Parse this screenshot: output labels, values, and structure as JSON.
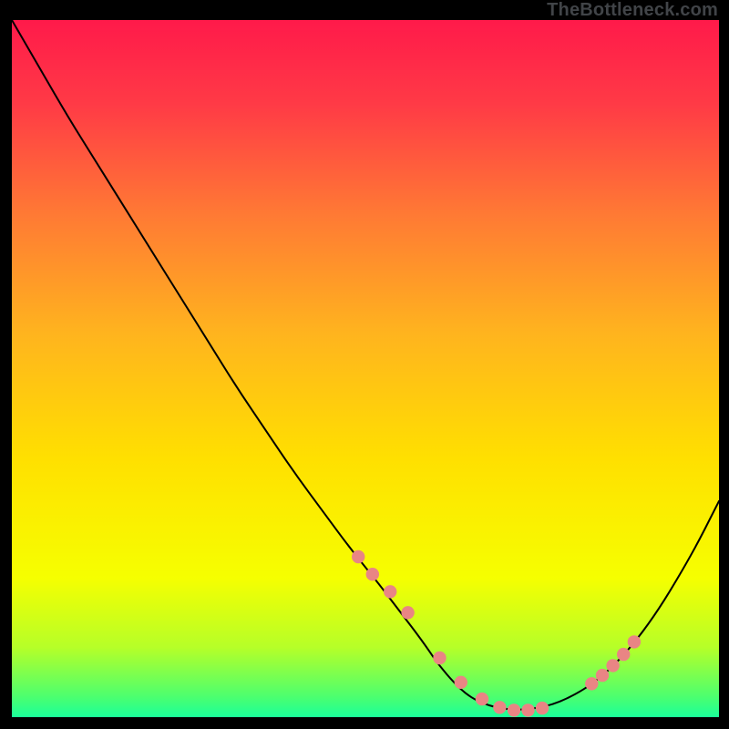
{
  "watermark": "TheBottleneck.com",
  "colors": {
    "black": "#000000",
    "curve": "#000000",
    "marker_fill": "#e98584",
    "marker_stroke": "#e98584",
    "gradient_stops": [
      {
        "offset": 0.0,
        "color": "#ff1a4a"
      },
      {
        "offset": 0.12,
        "color": "#ff3a46"
      },
      {
        "offset": 0.28,
        "color": "#ff7a34"
      },
      {
        "offset": 0.45,
        "color": "#ffb41e"
      },
      {
        "offset": 0.63,
        "color": "#ffe000"
      },
      {
        "offset": 0.8,
        "color": "#f6ff00"
      },
      {
        "offset": 0.9,
        "color": "#b6ff28"
      },
      {
        "offset": 0.97,
        "color": "#4dff6e"
      },
      {
        "offset": 1.0,
        "color": "#1aff9a"
      }
    ]
  },
  "chart_data": {
    "type": "line",
    "title": "",
    "xlabel": "",
    "ylabel": "",
    "xlim": [
      0,
      100
    ],
    "ylim": [
      0,
      100
    ],
    "grid": false,
    "legend": false,
    "series": [
      {
        "name": "bottleneck-curve",
        "x": [
          0,
          4,
          8,
          12,
          16,
          20,
          24,
          28,
          32,
          36,
          40,
          44,
          48,
          52,
          55,
          58,
          60,
          62,
          64,
          66,
          69,
          73,
          78,
          84,
          90,
          96,
          100
        ],
        "y": [
          100,
          93,
          86,
          79.5,
          73,
          66.5,
          60,
          53.5,
          47,
          41,
          35,
          29.5,
          24,
          19,
          15,
          11,
          8,
          5.5,
          3.5,
          2.2,
          1.2,
          1.0,
          2.2,
          6,
          13,
          23,
          31
        ]
      }
    ],
    "markers": {
      "name": "curve-dots",
      "x": [
        49,
        51,
        53.5,
        56,
        60.5,
        63.5,
        66.5,
        69,
        71,
        73,
        75,
        82,
        83.5,
        85,
        86.5,
        88
      ],
      "y": [
        23,
        20.5,
        18,
        15,
        8.5,
        5,
        2.6,
        1.4,
        1.0,
        1.0,
        1.3,
        4.8,
        6.0,
        7.4,
        9.0,
        10.8
      ]
    }
  }
}
